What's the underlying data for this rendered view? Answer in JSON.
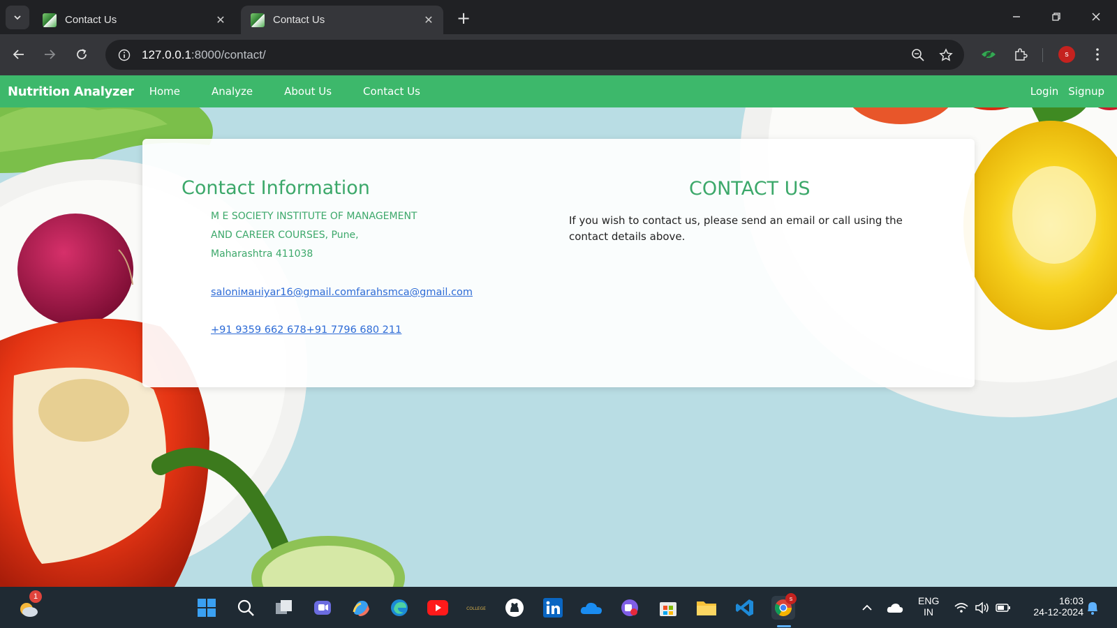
{
  "browser": {
    "tabs": [
      {
        "title": "Contact Us",
        "active": false
      },
      {
        "title": "Contact Us",
        "active": true
      }
    ],
    "url_host": "127.0.0.1",
    "url_path": ":8000/contact/",
    "profile_initial": "s"
  },
  "site": {
    "brand": "Nutrition Analyzer",
    "nav": [
      "Home",
      "Analyze",
      "About Us",
      "Contact Us"
    ],
    "auth": [
      "Login",
      "Signup"
    ],
    "colors": {
      "nav_bg": "#3db86b",
      "heading": "#3ca86a",
      "link": "#2d6bd6"
    }
  },
  "contact": {
    "info_title": "Contact Information",
    "address_lines": [
      "M E SOCIETY INSTITUTE OF MANAGEMENT",
      "AND CAREER COURSES, Pune,",
      "Maharashtra 411038"
    ],
    "email": "saloniманiyar16@gmail.comfarahsmca@gmail.com",
    "phone": "+91 9359 662 678+91 7796 680 211",
    "us_title": "CONTACT US",
    "us_text": "If you wish to contact us, please send an email or call using the contact details above."
  },
  "taskbar": {
    "weather_badge": "1",
    "lang_top": "ENG",
    "lang_bottom": "IN",
    "time": "16:03",
    "date": "24-12-2024",
    "chrome_badge": "s"
  }
}
